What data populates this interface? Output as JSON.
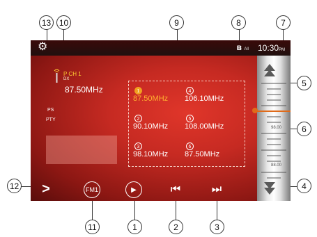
{
  "status": {
    "time": "10:30",
    "time_suffix": "PM",
    "bt_symbol": "ʙ",
    "bt_sub": "All"
  },
  "tuner_info": {
    "station_name": "P CH 1",
    "reception": "DX",
    "frequency": "87.50MHz",
    "ps_label": "PS",
    "pty_label": "PTY"
  },
  "presets": [
    {
      "num": "1",
      "freq": "87.50MHz",
      "active": true
    },
    {
      "num": "4",
      "freq": "106.10MHz",
      "active": false
    },
    {
      "num": "2",
      "freq": "90.10MHz",
      "active": false
    },
    {
      "num": "5",
      "freq": "108.00MHz",
      "active": false
    },
    {
      "num": "3",
      "freq": "98.10MHz",
      "active": false
    },
    {
      "num": "6",
      "freq": "87.50MHz",
      "active": false
    }
  ],
  "tuning_scale": {
    "labels": [
      "98.00",
      "88.00"
    ]
  },
  "controls": {
    "band_label": "FM1",
    "menu_symbol": ">",
    "scan_symbol": "▶",
    "prev_symbol": "⏮",
    "next_symbol": "⏭"
  },
  "callouts": [
    "1",
    "2",
    "3",
    "4",
    "5",
    "6",
    "7",
    "8",
    "9",
    "10",
    "11",
    "12",
    "13"
  ]
}
